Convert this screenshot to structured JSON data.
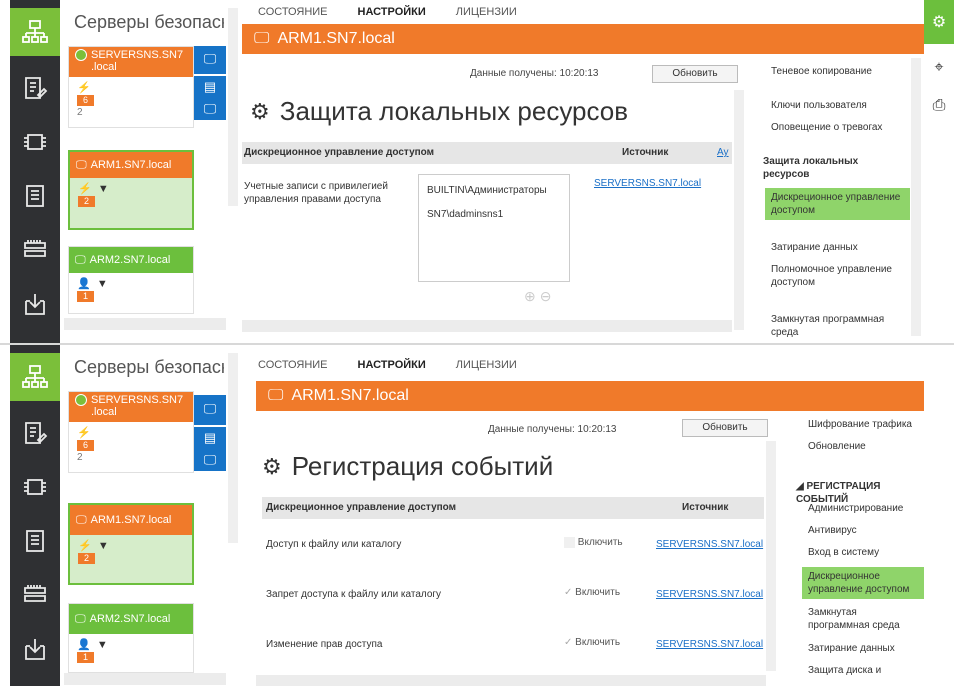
{
  "tabs": [
    "СОСТОЯНИЕ",
    "НАСТРОЙКИ",
    "ЛИЦЕНЗИИ"
  ],
  "active_tab": "НАСТРОЙКИ",
  "servers_title": "Серверы безопасн",
  "host": "ARM1.SN7.local",
  "received_label": "Данные получены:",
  "received_time": "10:20:13",
  "refresh_label": "Обновить",
  "cards": {
    "server": {
      "name_1": "SERVERSNS.SN7",
      "name_2": ".local",
      "count": "6",
      "count2": "2"
    },
    "arm1": {
      "name": "ARM1.SN7.local",
      "count": "2"
    },
    "arm2": {
      "name": "ARM2.SN7.local",
      "count": "1"
    }
  },
  "panel1": {
    "page_title": "Защита локальных ресурсов",
    "table_header": "Дискреционное управление доступом",
    "source_header": "Источник",
    "extra_header": "Ау",
    "row_label_1": "Учетные записи с привилегией",
    "row_label_2": "управления правами доступа",
    "accounts": [
      "BUILTIN\\Администраторы",
      "SN7\\dadminsns1"
    ],
    "source_value": "SERVERSNS.SN7.local",
    "nav": [
      {
        "label": "Теневое копирование",
        "selected": false
      },
      {
        "label": "Ключи пользователя",
        "selected": false
      },
      {
        "label": "Оповещение о тревогах",
        "selected": false
      },
      {
        "label": "Защита локальных ресурсов",
        "selected": false,
        "group": true
      },
      {
        "label": "Дискреционное управление доступом",
        "selected": true
      },
      {
        "label": "Затирание данных",
        "selected": false
      },
      {
        "label": "Полномочное управление доступом",
        "selected": false
      },
      {
        "label": "Замкнутая программная среда",
        "selected": false
      }
    ]
  },
  "panel2": {
    "page_title": "Регистрация событий",
    "table_header": "Дискреционное управление доступом",
    "source_header": "Источник",
    "rows": [
      {
        "label": "Доступ к файлу или каталогу",
        "check": "Включить",
        "checked": false,
        "source": "SERVERSNS.SN7.local"
      },
      {
        "label": "Запрет доступа к файлу или каталогу",
        "check": "Включить",
        "checked": true,
        "source": "SERVERSNS.SN7.local"
      },
      {
        "label": "Изменение прав доступа",
        "check": "Включить",
        "checked": true,
        "source": "SERVERSNS.SN7.local"
      }
    ],
    "nav_top": [
      "Шифрование трафика",
      "Обновление"
    ],
    "nav_group": "РЕГИСТРАЦИЯ СОБЫТИЙ",
    "nav": [
      {
        "label": "Администрирование",
        "selected": false
      },
      {
        "label": "Антивирус",
        "selected": false
      },
      {
        "label": "Вход в систему",
        "selected": false
      },
      {
        "label": "Дискреционное управление доступом",
        "selected": true
      },
      {
        "label": "Замкнутая программная среда",
        "selected": false
      },
      {
        "label": "Затирание данных",
        "selected": false
      },
      {
        "label": "Защита диска и",
        "selected": false
      }
    ]
  },
  "colors": {
    "accent_orange": "#f07a2a",
    "accent_green": "#6cbf3d",
    "nav_selected": "#8fd46a",
    "rail": "#2f3033",
    "link": "#1a6fc7"
  },
  "icons": [
    "network-icon",
    "policy-icon",
    "chip-icon",
    "server-icon",
    "storage-icon",
    "download-icon",
    "gear-icon",
    "pin-icon",
    "print-icon",
    "monitor-icon",
    "key-icon",
    "filter-icon",
    "user-icon",
    "checkmark-icon",
    "add-icon",
    "remove-icon"
  ]
}
